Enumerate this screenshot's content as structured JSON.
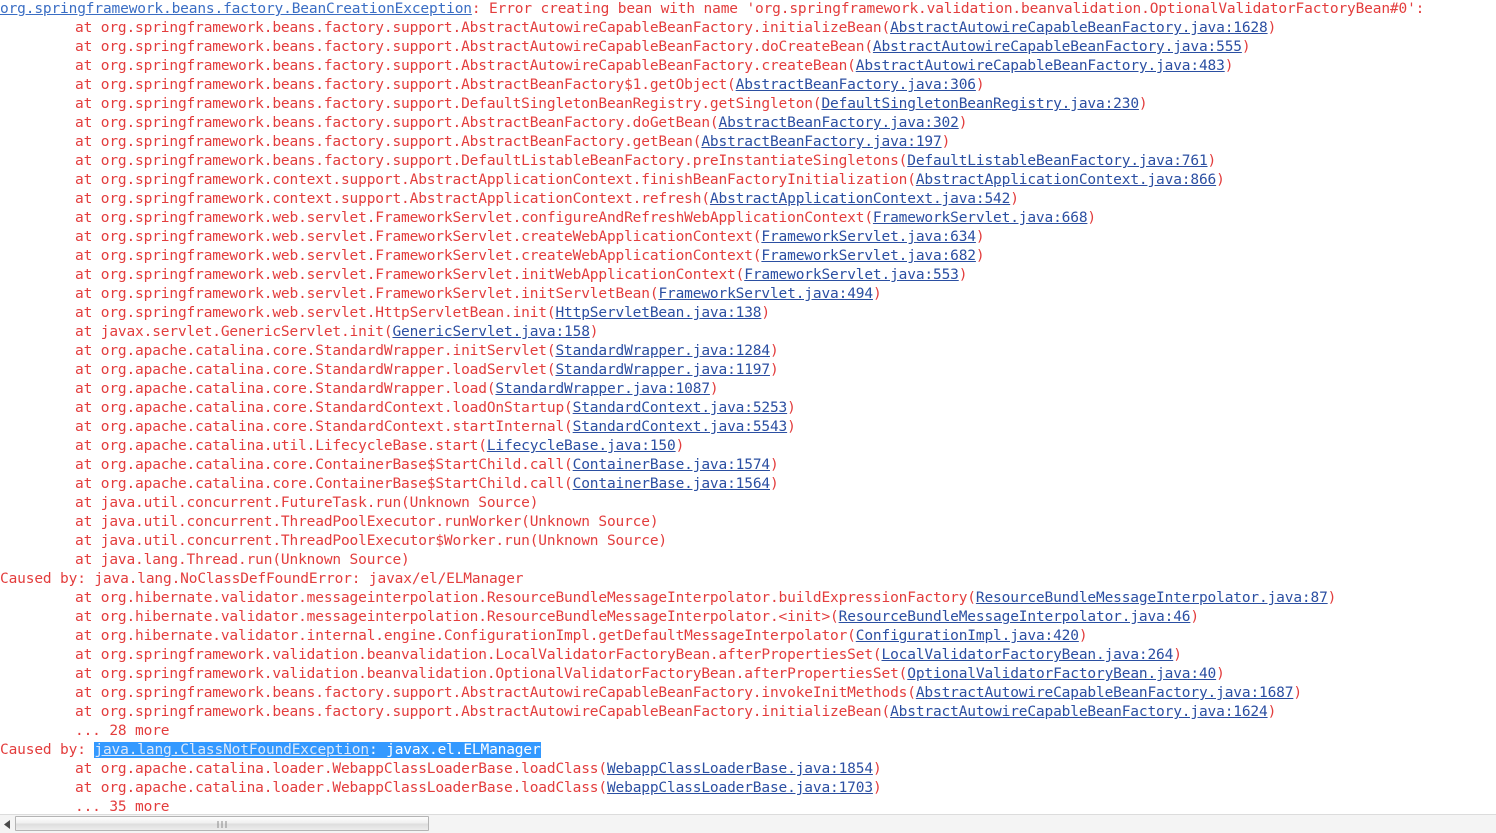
{
  "console": {
    "kind": "java-stack-trace",
    "colors": {
      "text_red": "#e33d3d",
      "link_blue": "#3b6ec4",
      "file_link_blue": "#2b4fa2",
      "selection_background": "#3399ff",
      "selection_text": "#ffffff",
      "page_background": "#ffffff"
    },
    "lines": [
      {
        "indent": 0,
        "segments": [
          {
            "kind": "link",
            "text": "org.springframework.beans.factory.BeanCreationException"
          },
          {
            "kind": "text",
            "text": ": Error creating bean with name 'org.springframework.validation.beanvalidation.OptionalValidatorFactoryBean#0':"
          }
        ]
      },
      {
        "indent": 1,
        "segments": [
          {
            "kind": "text",
            "text": "at org.springframework.beans.factory.support.AbstractAutowireCapableBeanFactory.initializeBean("
          },
          {
            "kind": "file",
            "text": "AbstractAutowireCapableBeanFactory.java:1628"
          },
          {
            "kind": "text",
            "text": ")"
          }
        ]
      },
      {
        "indent": 1,
        "segments": [
          {
            "kind": "text",
            "text": "at org.springframework.beans.factory.support.AbstractAutowireCapableBeanFactory.doCreateBean("
          },
          {
            "kind": "file",
            "text": "AbstractAutowireCapableBeanFactory.java:555"
          },
          {
            "kind": "text",
            "text": ")"
          }
        ]
      },
      {
        "indent": 1,
        "segments": [
          {
            "kind": "text",
            "text": "at org.springframework.beans.factory.support.AbstractAutowireCapableBeanFactory.createBean("
          },
          {
            "kind": "file",
            "text": "AbstractAutowireCapableBeanFactory.java:483"
          },
          {
            "kind": "text",
            "text": ")"
          }
        ]
      },
      {
        "indent": 1,
        "segments": [
          {
            "kind": "text",
            "text": "at org.springframework.beans.factory.support.AbstractBeanFactory$1.getObject("
          },
          {
            "kind": "file",
            "text": "AbstractBeanFactory.java:306"
          },
          {
            "kind": "text",
            "text": ")"
          }
        ]
      },
      {
        "indent": 1,
        "segments": [
          {
            "kind": "text",
            "text": "at org.springframework.beans.factory.support.DefaultSingletonBeanRegistry.getSingleton("
          },
          {
            "kind": "file",
            "text": "DefaultSingletonBeanRegistry.java:230"
          },
          {
            "kind": "text",
            "text": ")"
          }
        ]
      },
      {
        "indent": 1,
        "segments": [
          {
            "kind": "text",
            "text": "at org.springframework.beans.factory.support.AbstractBeanFactory.doGetBean("
          },
          {
            "kind": "file",
            "text": "AbstractBeanFactory.java:302"
          },
          {
            "kind": "text",
            "text": ")"
          }
        ]
      },
      {
        "indent": 1,
        "segments": [
          {
            "kind": "text",
            "text": "at org.springframework.beans.factory.support.AbstractBeanFactory.getBean("
          },
          {
            "kind": "file",
            "text": "AbstractBeanFactory.java:197"
          },
          {
            "kind": "text",
            "text": ")"
          }
        ]
      },
      {
        "indent": 1,
        "segments": [
          {
            "kind": "text",
            "text": "at org.springframework.beans.factory.support.DefaultListableBeanFactory.preInstantiateSingletons("
          },
          {
            "kind": "file",
            "text": "DefaultListableBeanFactory.java:761"
          },
          {
            "kind": "text",
            "text": ")"
          }
        ]
      },
      {
        "indent": 1,
        "segments": [
          {
            "kind": "text",
            "text": "at org.springframework.context.support.AbstractApplicationContext.finishBeanFactoryInitialization("
          },
          {
            "kind": "file",
            "text": "AbstractApplicationContext.java:866"
          },
          {
            "kind": "text",
            "text": ")"
          }
        ]
      },
      {
        "indent": 1,
        "segments": [
          {
            "kind": "text",
            "text": "at org.springframework.context.support.AbstractApplicationContext.refresh("
          },
          {
            "kind": "file",
            "text": "AbstractApplicationContext.java:542"
          },
          {
            "kind": "text",
            "text": ")"
          }
        ]
      },
      {
        "indent": 1,
        "segments": [
          {
            "kind": "text",
            "text": "at org.springframework.web.servlet.FrameworkServlet.configureAndRefreshWebApplicationContext("
          },
          {
            "kind": "file",
            "text": "FrameworkServlet.java:668"
          },
          {
            "kind": "text",
            "text": ")"
          }
        ]
      },
      {
        "indent": 1,
        "segments": [
          {
            "kind": "text",
            "text": "at org.springframework.web.servlet.FrameworkServlet.createWebApplicationContext("
          },
          {
            "kind": "file",
            "text": "FrameworkServlet.java:634"
          },
          {
            "kind": "text",
            "text": ")"
          }
        ]
      },
      {
        "indent": 1,
        "segments": [
          {
            "kind": "text",
            "text": "at org.springframework.web.servlet.FrameworkServlet.createWebApplicationContext("
          },
          {
            "kind": "file",
            "text": "FrameworkServlet.java:682"
          },
          {
            "kind": "text",
            "text": ")"
          }
        ]
      },
      {
        "indent": 1,
        "segments": [
          {
            "kind": "text",
            "text": "at org.springframework.web.servlet.FrameworkServlet.initWebApplicationContext("
          },
          {
            "kind": "file",
            "text": "FrameworkServlet.java:553"
          },
          {
            "kind": "text",
            "text": ")"
          }
        ]
      },
      {
        "indent": 1,
        "segments": [
          {
            "kind": "text",
            "text": "at org.springframework.web.servlet.FrameworkServlet.initServletBean("
          },
          {
            "kind": "file",
            "text": "FrameworkServlet.java:494"
          },
          {
            "kind": "text",
            "text": ")"
          }
        ]
      },
      {
        "indent": 1,
        "segments": [
          {
            "kind": "text",
            "text": "at org.springframework.web.servlet.HttpServletBean.init("
          },
          {
            "kind": "file",
            "text": "HttpServletBean.java:138"
          },
          {
            "kind": "text",
            "text": ")"
          }
        ]
      },
      {
        "indent": 1,
        "segments": [
          {
            "kind": "text",
            "text": "at javax.servlet.GenericServlet.init("
          },
          {
            "kind": "file",
            "text": "GenericServlet.java:158"
          },
          {
            "kind": "text",
            "text": ")"
          }
        ]
      },
      {
        "indent": 1,
        "segments": [
          {
            "kind": "text",
            "text": "at org.apache.catalina.core.StandardWrapper.initServlet("
          },
          {
            "kind": "file",
            "text": "StandardWrapper.java:1284"
          },
          {
            "kind": "text",
            "text": ")"
          }
        ]
      },
      {
        "indent": 1,
        "segments": [
          {
            "kind": "text",
            "text": "at org.apache.catalina.core.StandardWrapper.loadServlet("
          },
          {
            "kind": "file",
            "text": "StandardWrapper.java:1197"
          },
          {
            "kind": "text",
            "text": ")"
          }
        ]
      },
      {
        "indent": 1,
        "segments": [
          {
            "kind": "text",
            "text": "at org.apache.catalina.core.StandardWrapper.load("
          },
          {
            "kind": "file",
            "text": "StandardWrapper.java:1087"
          },
          {
            "kind": "text",
            "text": ")"
          }
        ]
      },
      {
        "indent": 1,
        "segments": [
          {
            "kind": "text",
            "text": "at org.apache.catalina.core.StandardContext.loadOnStartup("
          },
          {
            "kind": "file",
            "text": "StandardContext.java:5253"
          },
          {
            "kind": "text",
            "text": ")"
          }
        ]
      },
      {
        "indent": 1,
        "segments": [
          {
            "kind": "text",
            "text": "at org.apache.catalina.core.StandardContext.startInternal("
          },
          {
            "kind": "file",
            "text": "StandardContext.java:5543"
          },
          {
            "kind": "text",
            "text": ")"
          }
        ]
      },
      {
        "indent": 1,
        "segments": [
          {
            "kind": "text",
            "text": "at org.apache.catalina.util.LifecycleBase.start("
          },
          {
            "kind": "file",
            "text": "LifecycleBase.java:150"
          },
          {
            "kind": "text",
            "text": ")"
          }
        ]
      },
      {
        "indent": 1,
        "segments": [
          {
            "kind": "text",
            "text": "at org.apache.catalina.core.ContainerBase$StartChild.call("
          },
          {
            "kind": "file",
            "text": "ContainerBase.java:1574"
          },
          {
            "kind": "text",
            "text": ")"
          }
        ]
      },
      {
        "indent": 1,
        "segments": [
          {
            "kind": "text",
            "text": "at org.apache.catalina.core.ContainerBase$StartChild.call("
          },
          {
            "kind": "file",
            "text": "ContainerBase.java:1564"
          },
          {
            "kind": "text",
            "text": ")"
          }
        ]
      },
      {
        "indent": 1,
        "segments": [
          {
            "kind": "text",
            "text": "at java.util.concurrent.FutureTask.run(Unknown Source)"
          }
        ]
      },
      {
        "indent": 1,
        "segments": [
          {
            "kind": "text",
            "text": "at java.util.concurrent.ThreadPoolExecutor.runWorker(Unknown Source)"
          }
        ]
      },
      {
        "indent": 1,
        "segments": [
          {
            "kind": "text",
            "text": "at java.util.concurrent.ThreadPoolExecutor$Worker.run(Unknown Source)"
          }
        ]
      },
      {
        "indent": 1,
        "segments": [
          {
            "kind": "text",
            "text": "at java.lang.Thread.run(Unknown Source)"
          }
        ]
      },
      {
        "indent": 0,
        "segments": [
          {
            "kind": "text",
            "text": "Caused by: java.lang.NoClassDefFoundError: javax/el/ELManager"
          }
        ]
      },
      {
        "indent": 1,
        "segments": [
          {
            "kind": "text",
            "text": "at org.hibernate.validator.messageinterpolation.ResourceBundleMessageInterpolator.buildExpressionFactory("
          },
          {
            "kind": "file",
            "text": "ResourceBundleMessageInterpolator.java:87"
          },
          {
            "kind": "text",
            "text": ")"
          }
        ]
      },
      {
        "indent": 1,
        "segments": [
          {
            "kind": "text",
            "text": "at org.hibernate.validator.messageinterpolation.ResourceBundleMessageInterpolator.<init>("
          },
          {
            "kind": "file",
            "text": "ResourceBundleMessageInterpolator.java:46"
          },
          {
            "kind": "text",
            "text": ")"
          }
        ]
      },
      {
        "indent": 1,
        "segments": [
          {
            "kind": "text",
            "text": "at org.hibernate.validator.internal.engine.ConfigurationImpl.getDefaultMessageInterpolator("
          },
          {
            "kind": "file",
            "text": "ConfigurationImpl.java:420"
          },
          {
            "kind": "text",
            "text": ")"
          }
        ]
      },
      {
        "indent": 1,
        "segments": [
          {
            "kind": "text",
            "text": "at org.springframework.validation.beanvalidation.LocalValidatorFactoryBean.afterPropertiesSet("
          },
          {
            "kind": "file",
            "text": "LocalValidatorFactoryBean.java:264"
          },
          {
            "kind": "text",
            "text": ")"
          }
        ]
      },
      {
        "indent": 1,
        "segments": [
          {
            "kind": "text",
            "text": "at org.springframework.validation.beanvalidation.OptionalValidatorFactoryBean.afterPropertiesSet("
          },
          {
            "kind": "file",
            "text": "OptionalValidatorFactoryBean.java:40"
          },
          {
            "kind": "text",
            "text": ")"
          }
        ]
      },
      {
        "indent": 1,
        "segments": [
          {
            "kind": "text",
            "text": "at org.springframework.beans.factory.support.AbstractAutowireCapableBeanFactory.invokeInitMethods("
          },
          {
            "kind": "file",
            "text": "AbstractAutowireCapableBeanFactory.java:1687"
          },
          {
            "kind": "text",
            "text": ")"
          }
        ]
      },
      {
        "indent": 1,
        "segments": [
          {
            "kind": "text",
            "text": "at org.springframework.beans.factory.support.AbstractAutowireCapableBeanFactory.initializeBean("
          },
          {
            "kind": "file",
            "text": "AbstractAutowireCapableBeanFactory.java:1624"
          },
          {
            "kind": "text",
            "text": ")"
          }
        ]
      },
      {
        "indent": 1,
        "segments": [
          {
            "kind": "text",
            "text": "... 28 more"
          }
        ]
      },
      {
        "indent": 0,
        "segments": [
          {
            "kind": "text",
            "text": "Caused by: "
          },
          {
            "kind": "selection",
            "parts": [
              {
                "kind": "link",
                "text": "java.lang.ClassNotFoundException"
              },
              {
                "kind": "text",
                "text": ": javax.el.ELManager"
              }
            ]
          }
        ]
      },
      {
        "indent": 1,
        "segments": [
          {
            "kind": "text",
            "text": "at org.apache.catalina.loader.WebappClassLoaderBase.loadClass("
          },
          {
            "kind": "file",
            "text": "WebappClassLoaderBase.java:1854"
          },
          {
            "kind": "text",
            "text": ")"
          }
        ]
      },
      {
        "indent": 1,
        "segments": [
          {
            "kind": "text",
            "text": "at org.apache.catalina.loader.WebappClassLoaderBase.loadClass("
          },
          {
            "kind": "file",
            "text": "WebappClassLoaderBase.java:1703"
          },
          {
            "kind": "text",
            "text": ")"
          }
        ]
      },
      {
        "indent": 1,
        "segments": [
          {
            "kind": "text",
            "text": "... 35 more"
          }
        ]
      }
    ]
  },
  "scrollbar": {
    "orientation": "horizontal",
    "left_arrow_icon": "triangle-left-icon",
    "thumb_grip_icon": "grip-lines-icon"
  }
}
